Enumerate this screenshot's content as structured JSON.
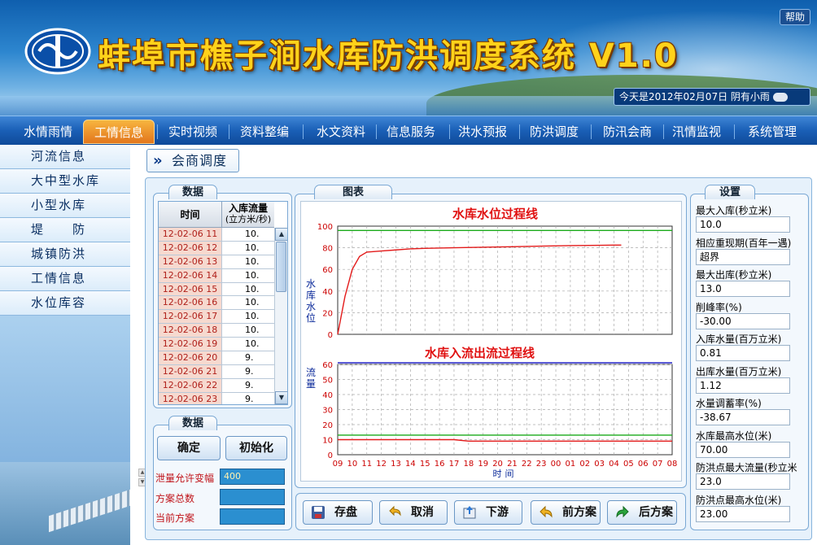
{
  "header": {
    "system_title": "蚌埠市樵子涧水库防洪调度系统 V1.0",
    "help_label": "帮助",
    "date_weather": "今天是2012年02月07日 阴有小雨"
  },
  "nav": {
    "items": [
      {
        "label": "水情雨情"
      },
      {
        "label": "工情信息"
      },
      {
        "label": "实时视频"
      },
      {
        "label": "资料整编"
      },
      {
        "label": "水文资料"
      },
      {
        "label": "信息服务"
      },
      {
        "label": "洪水预报"
      },
      {
        "label": "防洪调度"
      },
      {
        "label": "防汛会商"
      },
      {
        "label": "汛情监视"
      },
      {
        "label": "系统管理"
      }
    ],
    "active_index": 1
  },
  "sidebar": {
    "items": [
      {
        "label": "河流信息"
      },
      {
        "label": "大中型水库"
      },
      {
        "label": "小型水库"
      },
      {
        "label": "堤　　防"
      },
      {
        "label": "城镇防洪"
      },
      {
        "label": "工情信息"
      },
      {
        "label": "水位库容"
      }
    ]
  },
  "page": {
    "heading": "会商调度"
  },
  "data_panel": {
    "tab_label": "数据",
    "col_time": "时间",
    "col_flow": "入库流量",
    "col_flow_unit": "(立方米/秒)",
    "rows": [
      {
        "time": "12-02-06 11",
        "flow": "10."
      },
      {
        "time": "12-02-06 12",
        "flow": "10."
      },
      {
        "time": "12-02-06 13",
        "flow": "10."
      },
      {
        "time": "12-02-06 14",
        "flow": "10."
      },
      {
        "time": "12-02-06 15",
        "flow": "10."
      },
      {
        "time": "12-02-06 16",
        "flow": "10."
      },
      {
        "time": "12-02-06 17",
        "flow": "10."
      },
      {
        "time": "12-02-06 18",
        "flow": "10."
      },
      {
        "time": "12-02-06 19",
        "flow": "10."
      },
      {
        "time": "12-02-06 20",
        "flow": "9."
      },
      {
        "time": "12-02-06 21",
        "flow": "9."
      },
      {
        "time": "12-02-06 22",
        "flow": "9."
      },
      {
        "time": "12-02-06 23",
        "flow": "9."
      }
    ]
  },
  "data_panel2": {
    "tab_label": "数据",
    "confirm_label": "确定",
    "init_label": "初始化",
    "allow_range_label": "泄量允许变幅",
    "allow_range_value": "400",
    "plan_total_label": "方案总数",
    "plan_total_value": "",
    "current_plan_label": "当前方案",
    "current_plan_value": ""
  },
  "chart_panel": {
    "tab_label": "图表"
  },
  "chart_data": [
    {
      "type": "line",
      "title": "水库水位过程线",
      "ylabel": "水库水位",
      "xlabel": "",
      "ylim": [
        0,
        100
      ],
      "yticks": [
        0,
        20,
        40,
        60,
        80,
        100
      ],
      "grid": true,
      "x_index": [
        0,
        0.5,
        1,
        1.5,
        2,
        3,
        4,
        5,
        6,
        8,
        10,
        12,
        14,
        16,
        18,
        19,
        19.5
      ],
      "series": [
        {
          "color": "#e31b1b",
          "values": [
            0,
            35,
            60,
            72,
            76,
            77,
            78,
            79,
            79.5,
            80,
            80.5,
            81,
            81.5,
            82,
            82.3,
            82.5,
            82.5
          ]
        }
      ],
      "reference_lines": [
        {
          "color": "#1aaa1a",
          "value": 96
        }
      ]
    },
    {
      "type": "line",
      "title": "水库入流出流过程线",
      "ylabel": "流量",
      "xlabel": "时间",
      "ylim": [
        0,
        60
      ],
      "yticks": [
        0,
        10,
        20,
        30,
        40,
        50,
        60
      ],
      "grid": true,
      "categories": [
        "09",
        "10",
        "11",
        "12",
        "13",
        "14",
        "15",
        "16",
        "17",
        "18",
        "19",
        "20",
        "21",
        "22",
        "23",
        "00",
        "01",
        "02",
        "03",
        "04",
        "05",
        "06",
        "07",
        "08"
      ],
      "series": [
        {
          "color": "#e31b1b",
          "values": [
            10,
            10,
            10,
            10,
            10,
            10,
            10,
            10,
            10,
            9,
            9,
            9,
            9,
            9,
            9,
            9,
            9,
            9,
            9,
            9,
            9,
            9,
            9,
            9
          ]
        },
        {
          "color": "#1aaa1a",
          "values": [
            13,
            13,
            13,
            13,
            13,
            13,
            13,
            13,
            13,
            13,
            13,
            13,
            13,
            13,
            13,
            13,
            13,
            13,
            13,
            13,
            13,
            13,
            13,
            13
          ]
        },
        {
          "color": "#2424c8",
          "values": [
            63,
            63,
            63,
            63,
            63,
            63,
            63,
            63,
            63,
            63,
            63,
            63,
            63,
            63,
            63,
            63,
            63,
            63,
            63,
            63,
            63,
            63,
            63,
            63
          ]
        }
      ]
    }
  ],
  "actions": {
    "save_label": "存盘",
    "cancel_label": "取消",
    "downstream_label": "下游",
    "prev_plan_label": "前方案",
    "next_plan_label": "后方案"
  },
  "settings": {
    "tab_label": "设置",
    "fields": [
      {
        "label": "最大入库(秒立米)",
        "value": "10.0"
      },
      {
        "label": "相应重现期(百年一遇)",
        "value": "超界"
      },
      {
        "label": "最大出库(秒立米)",
        "value": "13.0"
      },
      {
        "label": "削峰率(%)",
        "value": "-30.00"
      },
      {
        "label": "入库水量(百万立米)",
        "value": "0.81"
      },
      {
        "label": "出库水量(百万立米)",
        "value": "1.12"
      },
      {
        "label": "水量调蓄率(%)",
        "value": "-38.67"
      },
      {
        "label": "水库最高水位(米)",
        "value": "70.00"
      },
      {
        "label": "防洪点最大流量(秒立米",
        "value": "23.0"
      },
      {
        "label": "防洪点最高水位(米)",
        "value": "23.00"
      }
    ]
  },
  "colors": {
    "nav_active": "#e2761d",
    "title_yellow": "#ffd21a",
    "time_cell_red": "#b0201a",
    "label_red": "#c0141a",
    "chart_title_red": "#e01111"
  }
}
